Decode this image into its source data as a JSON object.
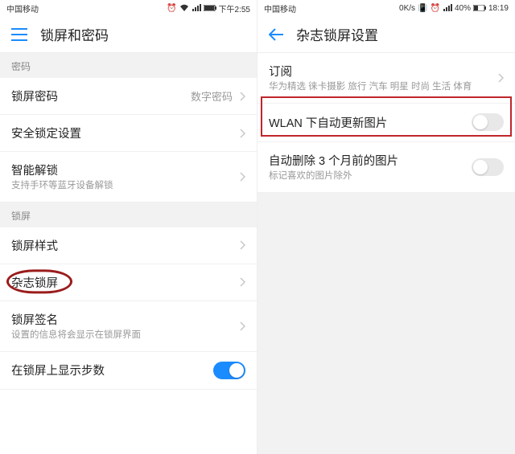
{
  "left": {
    "status": {
      "carrier": "中国移动",
      "time": "下午2:55"
    },
    "title": "锁屏和密码",
    "sections": {
      "password_header": "密码",
      "lock_password": "锁屏密码",
      "lock_password_value": "数字密码",
      "secure_lock": "安全锁定设置",
      "smart_unlock": "智能解锁",
      "smart_unlock_sub": "支持手环等蓝牙设备解锁",
      "lockscreen_header": "锁屏",
      "lockscreen_style": "锁屏样式",
      "magazine_lock": "杂志锁屏",
      "lock_signature": "锁屏签名",
      "lock_signature_sub": "设置的信息将会显示在锁屏界面",
      "show_steps": "在锁屏上显示步数"
    }
  },
  "right": {
    "status": {
      "carrier": "中国移动",
      "speed": "0K/s",
      "battery": "40%",
      "time": "18:19"
    },
    "title": "杂志锁屏设置",
    "rows": {
      "subscribe": "订阅",
      "subscribe_sub": "华为精选 徕卡摄影 旅行 汽车 明星 时尚 生活 体育",
      "wlan_update": "WLAN 下自动更新图片",
      "auto_delete": "自动删除 3 个月前的图片",
      "auto_delete_sub": "标记喜欢的图片除外"
    }
  }
}
